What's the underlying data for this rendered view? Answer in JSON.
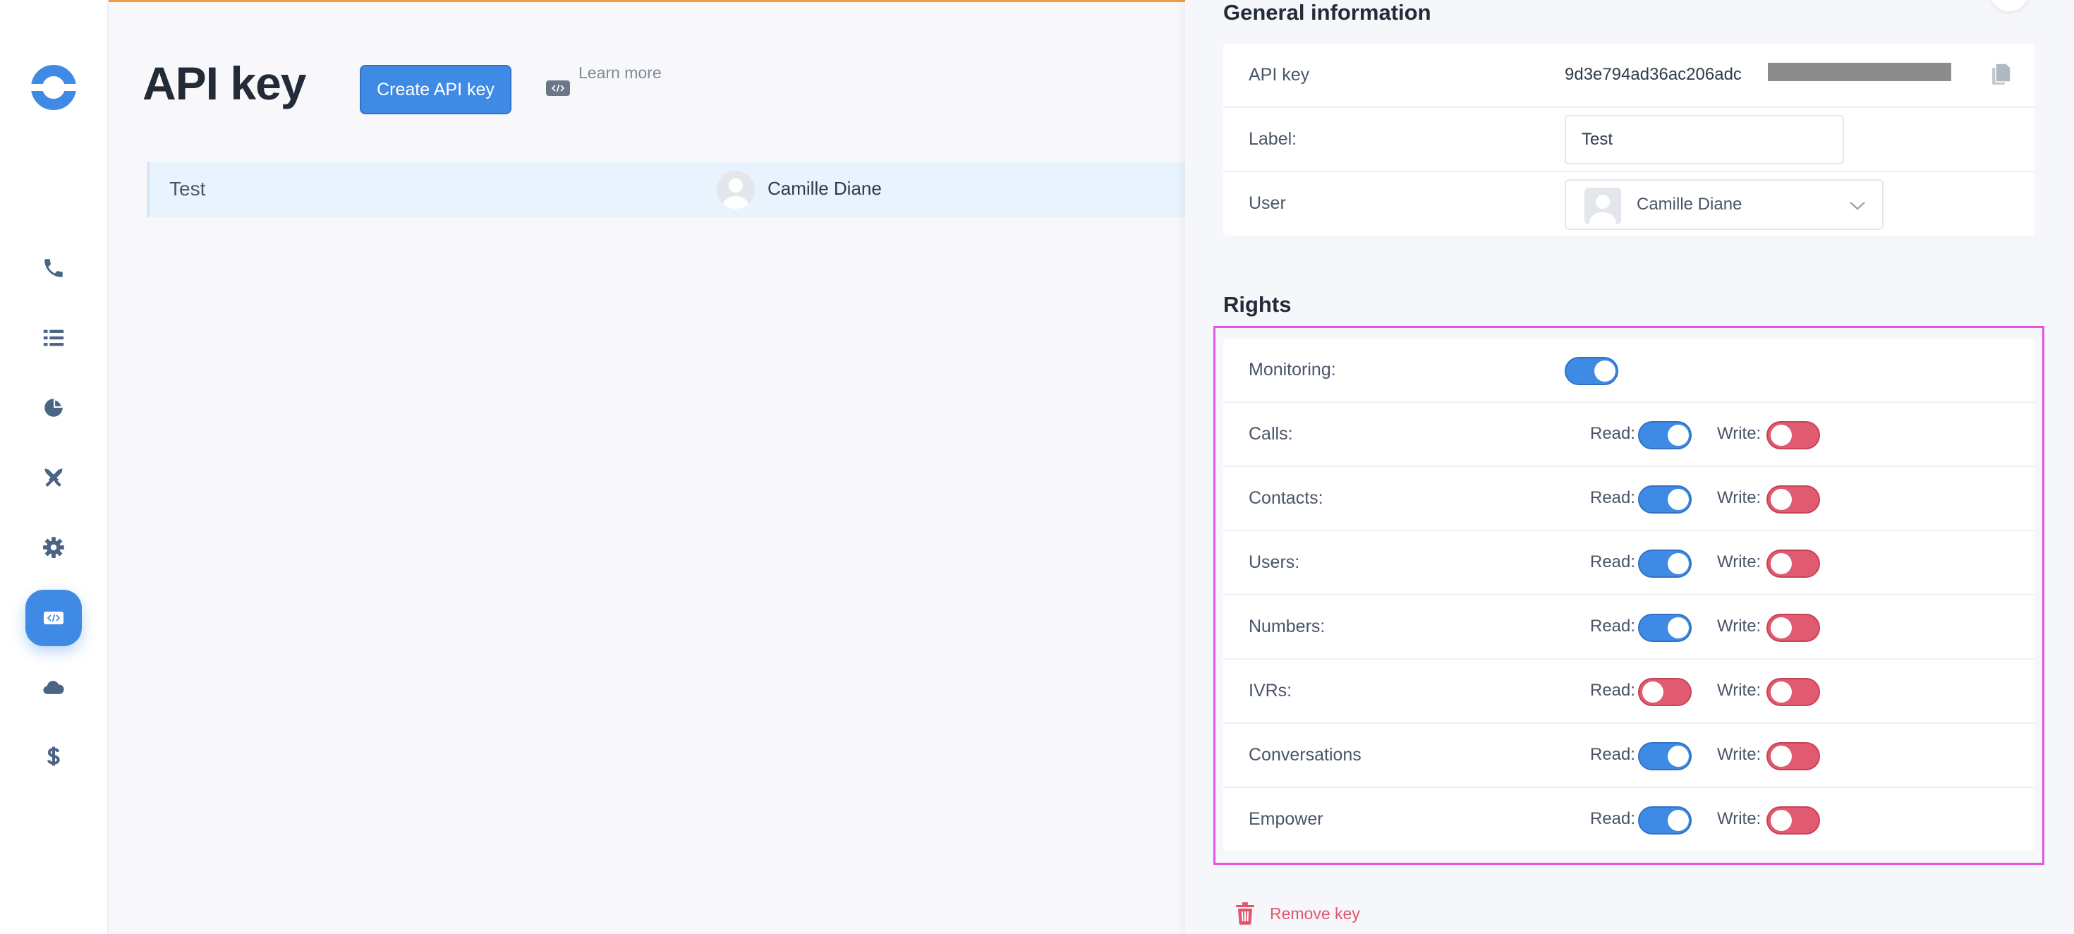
{
  "page": {
    "title": "API key"
  },
  "toolbar": {
    "create_label": "Create API key",
    "learn_more_label": "Learn more"
  },
  "table": {
    "rows": [
      {
        "label": "Test",
        "user": "Camille Diane"
      }
    ]
  },
  "sidebar": {
    "items": [
      {
        "icon": "phone-icon",
        "active": false
      },
      {
        "icon": "list-icon",
        "active": false
      },
      {
        "icon": "pie-chart-icon",
        "active": false
      },
      {
        "icon": "tools-icon",
        "active": false
      },
      {
        "icon": "gear-icon",
        "active": false
      },
      {
        "icon": "code-icon",
        "active": true
      },
      {
        "icon": "cloud-icon",
        "active": false
      },
      {
        "icon": "dollar-icon",
        "active": false
      }
    ]
  },
  "drawer": {
    "general_title": "General information",
    "api_key": {
      "label": "API key",
      "value": "9d3e794ad36ac206adc"
    },
    "label_field": {
      "label": "Label:",
      "value": "Test"
    },
    "user_field": {
      "label": "User",
      "value": "Camille Diane"
    },
    "rights_title": "Rights",
    "read_label": "Read:",
    "write_label": "Write:",
    "monitoring": {
      "label": "Monitoring:",
      "on": true
    },
    "rights": [
      {
        "label": "Calls:",
        "read": true,
        "write": false
      },
      {
        "label": "Contacts:",
        "read": true,
        "write": false
      },
      {
        "label": "Users:",
        "read": true,
        "write": false
      },
      {
        "label": "Numbers:",
        "read": true,
        "write": false
      },
      {
        "label": "IVRs:",
        "read": false,
        "write": false
      },
      {
        "label": "Conversations",
        "read": true,
        "write": false
      },
      {
        "label": "Empower",
        "read": true,
        "write": false
      }
    ],
    "remove_label": "Remove key"
  },
  "colors": {
    "accent": "#3f8ae4",
    "danger": "#e05a70",
    "highlight": "#e256e3",
    "top_bar": "#f2994a"
  }
}
